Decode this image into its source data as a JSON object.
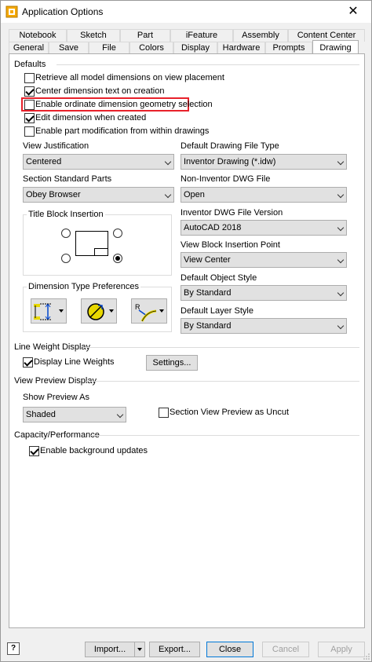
{
  "window": {
    "title": "Application Options",
    "close_label": "✕"
  },
  "tabs_row1": [
    "Notebook",
    "Sketch",
    "Part",
    "iFeature",
    "Assembly",
    "Content Center"
  ],
  "tabs_row2": [
    "General",
    "Save",
    "File",
    "Colors",
    "Display",
    "Hardware",
    "Prompts",
    "Drawing"
  ],
  "active_tab": "Drawing",
  "defaults": {
    "title": "Defaults",
    "options": [
      {
        "label": "Retrieve all model dimensions on view placement",
        "checked": false
      },
      {
        "label": "Center dimension text on creation",
        "checked": true
      },
      {
        "label": "Enable ordinate dimension geometry selection",
        "checked": false
      },
      {
        "label": "Edit dimension when created",
        "checked": true
      },
      {
        "label": "Enable part modification from within drawings",
        "checked": false
      }
    ],
    "view_justification": {
      "label": "View Justification",
      "value": "Centered"
    },
    "section_standard_parts": {
      "label": "Section Standard Parts",
      "value": "Obey Browser"
    },
    "title_block_insertion": {
      "label": "Title Block Insertion"
    },
    "dimension_type_preferences": {
      "label": "Dimension Type Preferences"
    },
    "default_drawing_file_type": {
      "label": "Default Drawing File Type",
      "value": "Inventor Drawing (*.idw)"
    },
    "non_inventor_dwg_file": {
      "label": "Non-Inventor DWG File",
      "value": "Open"
    },
    "inventor_dwg_file_version": {
      "label": "Inventor DWG File Version",
      "value": "AutoCAD 2018"
    },
    "view_block_insertion_point": {
      "label": "View Block Insertion Point",
      "value": "View Center"
    },
    "default_object_style": {
      "label": "Default Object Style",
      "value": "By Standard"
    },
    "default_layer_style": {
      "label": "Default Layer Style",
      "value": "By Standard"
    }
  },
  "line_weight_display": {
    "title": "Line Weight Display",
    "display_line_weights": {
      "label": "Display Line Weights",
      "checked": true
    },
    "settings_button": "Settings..."
  },
  "view_preview_display": {
    "title": "View Preview Display",
    "show_preview_as": {
      "label": "Show Preview As",
      "value": "Shaded"
    },
    "section_view_preview_as_uncut": {
      "label": "Section View Preview as Uncut",
      "checked": false
    }
  },
  "capacity_performance": {
    "title": "Capacity/Performance",
    "enable_background_updates": {
      "label": "Enable background updates",
      "checked": true
    }
  },
  "footer": {
    "import_label": "Import...",
    "export_label": "Export...",
    "close_label": "Close",
    "cancel_label": "Cancel",
    "apply_label": "Apply",
    "help_label": "?"
  },
  "colors": {
    "highlight": "#e8212b",
    "accent": "#0078d7"
  }
}
